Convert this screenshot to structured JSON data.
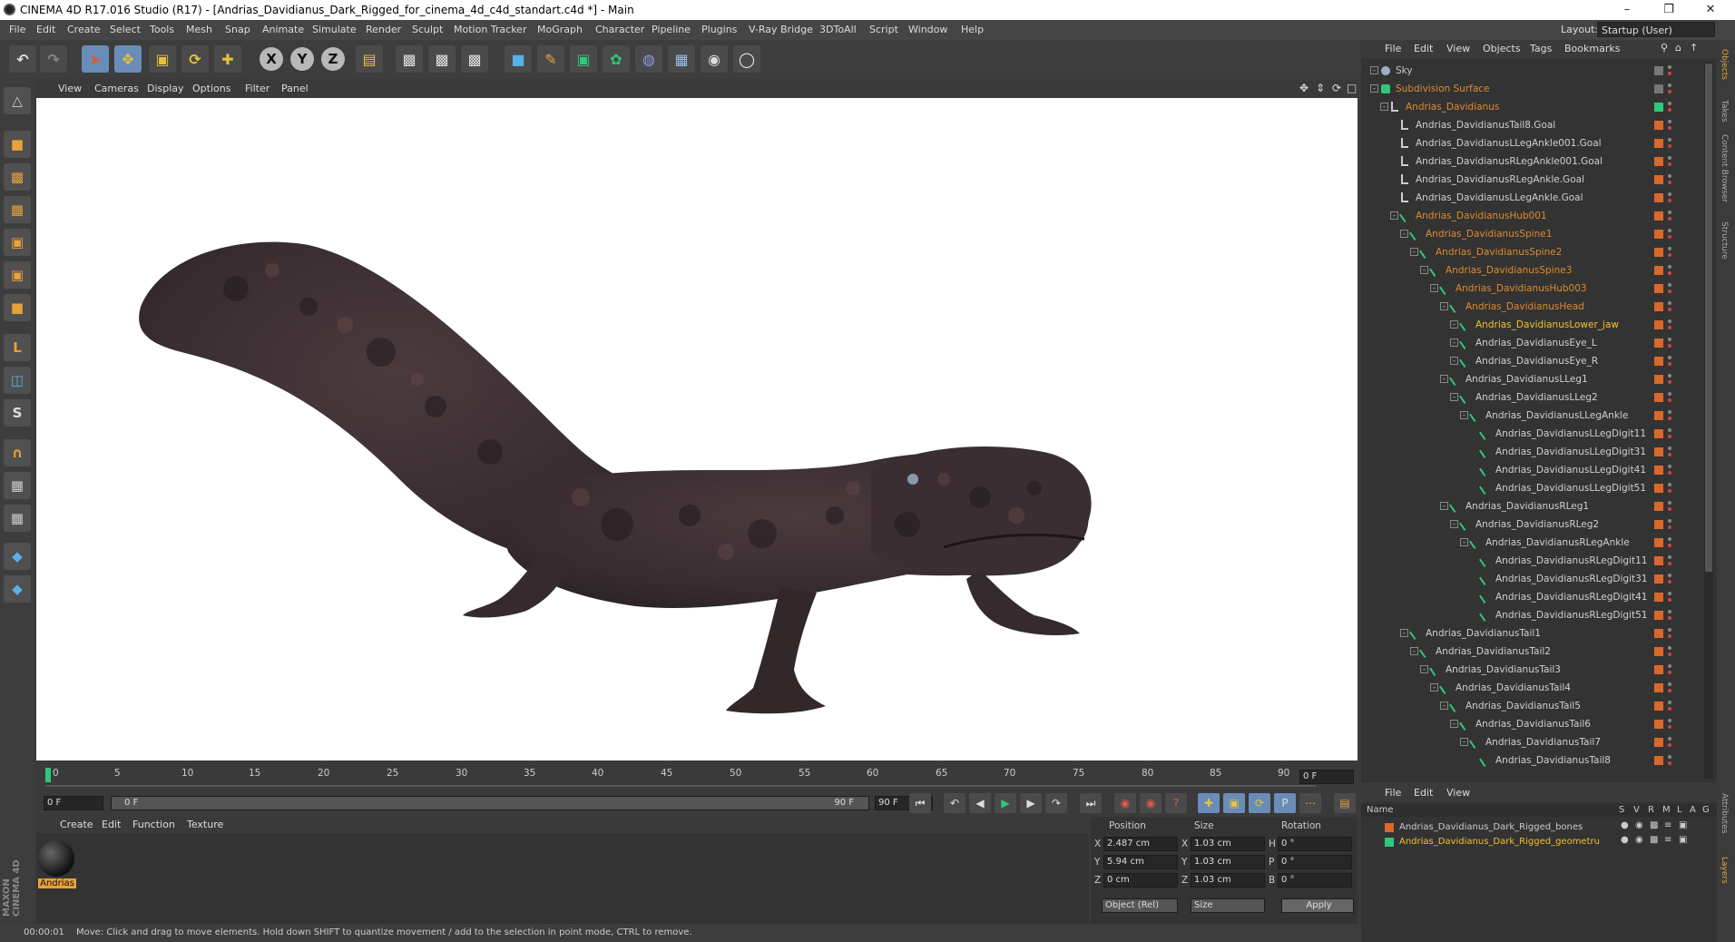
{
  "window": {
    "title": "CINEMA 4D R17.016 Studio (R17) - [Andrias_Davidianus_Dark_Rigged_for_cinema_4d_c4d_standart.c4d *] - Main",
    "min_icon": "minimize-icon",
    "restore_icon": "restore-icon",
    "close_icon": "close-icon"
  },
  "menubar": {
    "items": [
      "File",
      "Edit",
      "Create",
      "Select",
      "Tools",
      "Mesh",
      "Snap",
      "Animate",
      "Simulate",
      "Render",
      "Sculpt",
      "Motion Tracker",
      "MoGraph",
      "Character",
      "Pipeline",
      "Plugins",
      "V-Ray Bridge",
      "3DToAll",
      "Script",
      "Window",
      "Help"
    ],
    "layout_label": "Layout:",
    "layout_value": "Startup (User)"
  },
  "toolbar": {
    "icons": [
      "undo-icon",
      "redo-icon",
      "select-arrow-icon",
      "move-icon",
      "scale-icon",
      "rotate-icon",
      "transform-icon",
      "x-axis-icon",
      "y-axis-icon",
      "z-axis-icon",
      "coordinate-system-icon",
      "render-view-icon",
      "render-picture-viewer-icon",
      "render-settings-icon",
      "cube-icon",
      "pen-icon",
      "subdivision-icon",
      "cloner-icon",
      "deformer-icon",
      "floor-icon",
      "camera-icon",
      "light-icon"
    ],
    "xyz": [
      "X",
      "Y",
      "Z"
    ]
  },
  "viewport": {
    "menu": [
      "View",
      "Cameras",
      "Display",
      "Options",
      "Filter",
      "Panel"
    ]
  },
  "timeline": {
    "ticks": [
      "0",
      "5",
      "10",
      "15",
      "20",
      "25",
      "30",
      "35",
      "40",
      "45",
      "50",
      "55",
      "60",
      "65",
      "70",
      "75",
      "80",
      "85",
      "90"
    ],
    "current_frame": "0 F",
    "start": "0 F",
    "range_start": "0 F",
    "range_end": "90 F",
    "end": "90 F"
  },
  "materials": {
    "menu": [
      "Create",
      "Edit",
      "Function",
      "Texture"
    ],
    "items": [
      {
        "name": "Andrias"
      }
    ]
  },
  "coords": {
    "headers": {
      "position": "Position",
      "size": "Size",
      "rotation": "Rotation"
    },
    "rows": [
      {
        "axis": "X",
        "pos": "2.487 cm",
        "size_axis": "X",
        "size": "1.03 cm",
        "rot_axis": "H",
        "rot": "0 °"
      },
      {
        "axis": "Y",
        "pos": "5.94 cm",
        "size_axis": "Y",
        "size": "1.03 cm",
        "rot_axis": "P",
        "rot": "0 °"
      },
      {
        "axis": "Z",
        "pos": "0 cm",
        "size_axis": "Z",
        "size": "1.03 cm",
        "rot_axis": "B",
        "rot": "0 °"
      }
    ],
    "mode": "Object (Rel)",
    "size_mode": "Size",
    "apply": "Apply"
  },
  "status": {
    "time": "00:00:01",
    "message": "Move: Click and drag to move elements. Hold down SHIFT to quantize movement / add to the selection in point mode, CTRL to remove."
  },
  "object_manager": {
    "menu": [
      "File",
      "Edit",
      "View",
      "Objects",
      "Tags",
      "Bookmarks"
    ],
    "objects": [
      {
        "name": "Sky",
        "indent": 0,
        "type": "sky",
        "color": "#c8c8c8"
      },
      {
        "name": "Subdivision Surface",
        "indent": 0,
        "type": "subd",
        "color": "#e08a2c"
      },
      {
        "name": "Andrias_Davidianus",
        "indent": 1,
        "type": "null",
        "color": "#e08a2c"
      },
      {
        "name": "Andrias_DavidianusTail8.Goal",
        "indent": 2,
        "type": "null",
        "color": "#d0d0d0"
      },
      {
        "name": "Andrias_DavidianusLLegAnkle001.Goal",
        "indent": 2,
        "type": "null",
        "color": "#d0d0d0"
      },
      {
        "name": "Andrias_DavidianusRLegAnkle001.Goal",
        "indent": 2,
        "type": "null",
        "color": "#d0d0d0"
      },
      {
        "name": "Andrias_DavidianusRLegAnkle.Goal",
        "indent": 2,
        "type": "null",
        "color": "#d0d0d0"
      },
      {
        "name": "Andrias_DavidianusLLegAnkle.Goal",
        "indent": 2,
        "type": "null",
        "color": "#d0d0d0"
      },
      {
        "name": "Andrias_DavidianusHub001",
        "indent": 2,
        "type": "bone",
        "color": "#e08a2c"
      },
      {
        "name": "Andrias_DavidianusSpine1",
        "indent": 3,
        "type": "bone",
        "color": "#e08a2c"
      },
      {
        "name": "Andrias_DavidianusSpine2",
        "indent": 4,
        "type": "bone",
        "color": "#e08a2c"
      },
      {
        "name": "Andrias_DavidianusSpine3",
        "indent": 5,
        "type": "bone",
        "color": "#e08a2c"
      },
      {
        "name": "Andrias_DavidianusHub003",
        "indent": 6,
        "type": "bone",
        "color": "#e08a2c"
      },
      {
        "name": "Andrias_DavidianusHead",
        "indent": 7,
        "type": "bone",
        "color": "#e08a2c"
      },
      {
        "name": "Andrias_DavidianusLower_jaw",
        "indent": 8,
        "type": "bone",
        "color": "#f2c22a"
      },
      {
        "name": "Andrias_DavidianusEye_L",
        "indent": 8,
        "type": "bone",
        "color": "#d0d0d0"
      },
      {
        "name": "Andrias_DavidianusEye_R",
        "indent": 8,
        "type": "bone",
        "color": "#d0d0d0"
      },
      {
        "name": "Andrias_DavidianusLLeg1",
        "indent": 7,
        "type": "bone",
        "color": "#d0d0d0"
      },
      {
        "name": "Andrias_DavidianusLLeg2",
        "indent": 8,
        "type": "bone",
        "color": "#d0d0d0"
      },
      {
        "name": "Andrias_DavidianusLLegAnkle",
        "indent": 9,
        "type": "bone",
        "color": "#d0d0d0"
      },
      {
        "name": "Andrias_DavidianusLLegDigit11",
        "indent": 10,
        "type": "bone",
        "color": "#d0d0d0"
      },
      {
        "name": "Andrias_DavidianusLLegDigit31",
        "indent": 10,
        "type": "bone",
        "color": "#d0d0d0"
      },
      {
        "name": "Andrias_DavidianusLLegDigit41",
        "indent": 10,
        "type": "bone",
        "color": "#d0d0d0"
      },
      {
        "name": "Andrias_DavidianusLLegDigit51",
        "indent": 10,
        "type": "bone",
        "color": "#d0d0d0"
      },
      {
        "name": "Andrias_DavidianusRLeg1",
        "indent": 7,
        "type": "bone",
        "color": "#d0d0d0"
      },
      {
        "name": "Andrias_DavidianusRLeg2",
        "indent": 8,
        "type": "bone",
        "color": "#d0d0d0"
      },
      {
        "name": "Andrias_DavidianusRLegAnkle",
        "indent": 9,
        "type": "bone",
        "color": "#d0d0d0"
      },
      {
        "name": "Andrias_DavidianusRLegDigit11",
        "indent": 10,
        "type": "bone",
        "color": "#d0d0d0"
      },
      {
        "name": "Andrias_DavidianusRLegDigit31",
        "indent": 10,
        "type": "bone",
        "color": "#d0d0d0"
      },
      {
        "name": "Andrias_DavidianusRLegDigit41",
        "indent": 10,
        "type": "bone",
        "color": "#d0d0d0"
      },
      {
        "name": "Andrias_DavidianusRLegDigit51",
        "indent": 10,
        "type": "bone",
        "color": "#d0d0d0"
      },
      {
        "name": "Andrias_DavidianusTail1",
        "indent": 3,
        "type": "bone",
        "color": "#d0d0d0"
      },
      {
        "name": "Andrias_DavidianusTail2",
        "indent": 4,
        "type": "bone",
        "color": "#d0d0d0"
      },
      {
        "name": "Andrias_DavidianusTail3",
        "indent": 5,
        "type": "bone",
        "color": "#d0d0d0"
      },
      {
        "name": "Andrias_DavidianusTail4",
        "indent": 6,
        "type": "bone",
        "color": "#d0d0d0"
      },
      {
        "name": "Andrias_DavidianusTail5",
        "indent": 7,
        "type": "bone",
        "color": "#d0d0d0"
      },
      {
        "name": "Andrias_DavidianusTail6",
        "indent": 8,
        "type": "bone",
        "color": "#d0d0d0"
      },
      {
        "name": "Andrias_DavidianusTail7",
        "indent": 9,
        "type": "bone",
        "color": "#d0d0d0"
      },
      {
        "name": "Andrias_DavidianusTail8",
        "indent": 10,
        "type": "bone",
        "color": "#d0d0d0"
      }
    ]
  },
  "layer_manager": {
    "menu": [
      "File",
      "Edit",
      "View"
    ],
    "header": {
      "name": "Name",
      "cols": [
        "S",
        "V",
        "R",
        "M",
        "L",
        "A",
        "G"
      ]
    },
    "layers": [
      {
        "name": "Andrias_Davidianus_Dark_Rigged_bones",
        "color": "#d9682c"
      },
      {
        "name": "Andrias_Davidianus_Dark_Rigged_geometru",
        "color": "#2fc87a"
      }
    ]
  },
  "right_strip": {
    "tabs": [
      "Objects",
      "Takes",
      "Content Browser",
      "Structure"
    ],
    "tabs2": [
      "Attributes",
      "Layers"
    ]
  },
  "maxon": {
    "line1": "MAXON",
    "line2": "CINEMA 4D"
  }
}
